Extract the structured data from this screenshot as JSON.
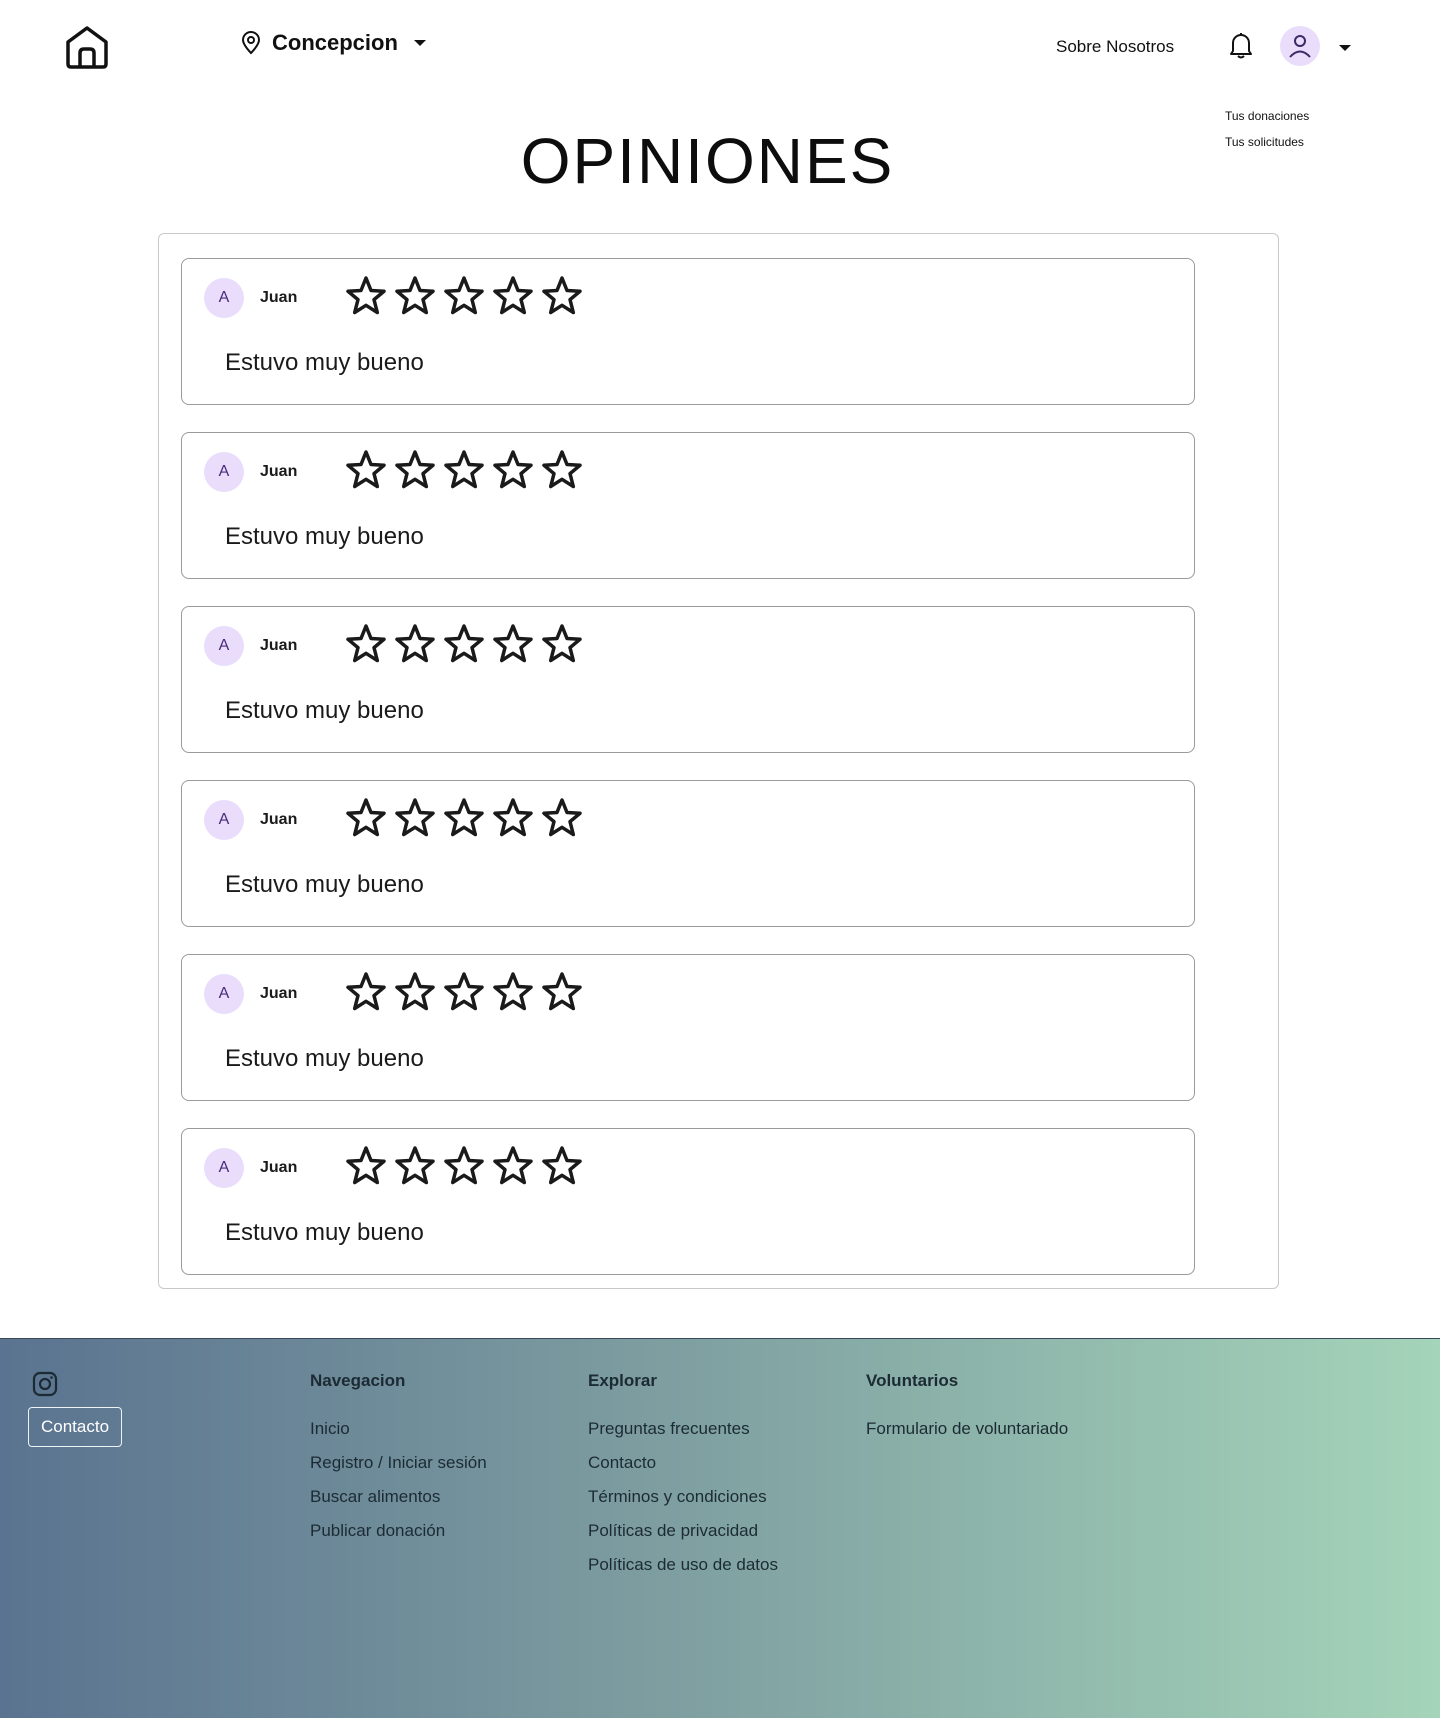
{
  "header": {
    "location_label": "Concepcion",
    "about_label": "Sobre Nosotros",
    "user_menu": [
      "Tus donaciones",
      "Tus solicitudes"
    ]
  },
  "page_title": "OPINIONES",
  "reviews": [
    {
      "initial": "A",
      "name": "Juan",
      "text": "Estuvo muy bueno",
      "rating": 0,
      "max_rating": 5
    },
    {
      "initial": "A",
      "name": "Juan",
      "text": "Estuvo muy bueno",
      "rating": 0,
      "max_rating": 5
    },
    {
      "initial": "A",
      "name": "Juan",
      "text": "Estuvo muy bueno",
      "rating": 0,
      "max_rating": 5
    },
    {
      "initial": "A",
      "name": "Juan",
      "text": "Estuvo muy bueno",
      "rating": 0,
      "max_rating": 5
    },
    {
      "initial": "A",
      "name": "Juan",
      "text": "Estuvo muy bueno",
      "rating": 0,
      "max_rating": 5
    },
    {
      "initial": "A",
      "name": "Juan",
      "text": "Estuvo muy bueno",
      "rating": 0,
      "max_rating": 5
    }
  ],
  "footer": {
    "contact_button": "Contacto",
    "columns": [
      {
        "heading": "Navegacion",
        "links": [
          "Inicio",
          "Registro / Iniciar sesión",
          "Buscar alimentos",
          "Publicar donación"
        ]
      },
      {
        "heading": "Explorar",
        "links": [
          "Preguntas frecuentes",
          "Contacto",
          "Términos y condiciones",
          "Políticas de privacidad",
          "Políticas de uso de datos"
        ]
      },
      {
        "heading": "Voluntarios",
        "links": [
          "Formulario de voluntariado"
        ]
      }
    ]
  },
  "icons": {
    "home": "home-icon",
    "location": "map-pin-icon",
    "notifications": "bell-icon",
    "user": "user-icon",
    "star": "star-outline-icon",
    "social": "instagram-icon"
  },
  "colors": {
    "avatar_bg": "#e9ddfb",
    "avatar_text": "#4b2a7a",
    "footer_gradient_start": "#5a7390",
    "footer_gradient_end": "#a4d4b9"
  }
}
